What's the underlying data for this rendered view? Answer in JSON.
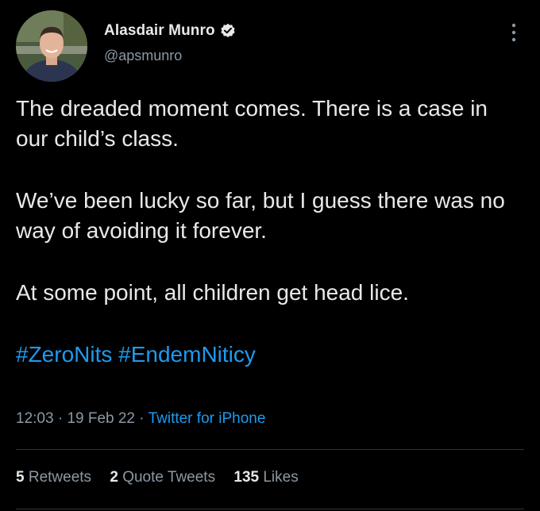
{
  "author": {
    "display_name": "Alasdair Munro",
    "handle": "@apsmunro",
    "verified": true,
    "avatar_icon": "profile-photo"
  },
  "tweet": {
    "paragraphs": [
      "The dreaded moment comes. There is a case in our child’s class.",
      "We’ve been lucky so far, but I guess there was no way of avoiding it forever.",
      "At some point, all children get head lice."
    ],
    "hashtags": [
      "#ZeroNits",
      "#EndemNiticy"
    ]
  },
  "meta": {
    "time": "12:03",
    "separator": "·",
    "date": "19 Feb 22",
    "source": "Twitter for iPhone"
  },
  "stats": {
    "retweets_count": "5",
    "retweets_label": "Retweets",
    "quotes_count": "2",
    "quotes_label": "Quote Tweets",
    "likes_count": "135",
    "likes_label": "Likes"
  },
  "colors": {
    "background": "#000000",
    "primary_text": "#e7e9ea",
    "secondary_text": "#8b98a5",
    "link": "#1d9bf0",
    "divider": "#2f3336"
  }
}
